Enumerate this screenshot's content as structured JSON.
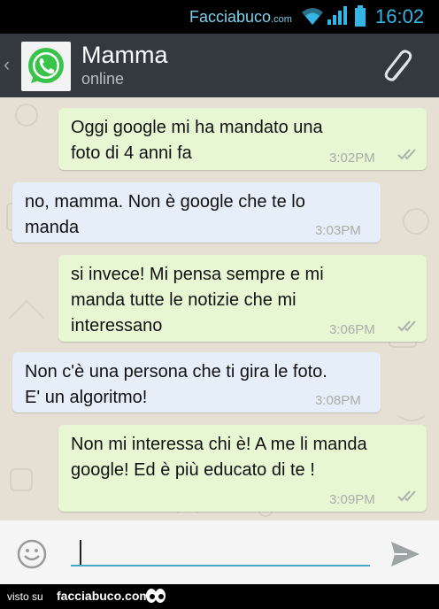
{
  "statusbar": {
    "watermark_main": "Facciabuco",
    "watermark_suffix": ".com",
    "time": "16:02"
  },
  "header": {
    "back_glyph": "‹",
    "contact_name": "Mamma",
    "contact_status": "online"
  },
  "messages": [
    {
      "direction": "out",
      "text": "Oggi google mi ha mandato una foto di 4 anni fa",
      "time": "3:02PM"
    },
    {
      "direction": "in",
      "text": "no, mamma. Non è google che te lo manda",
      "time": "3:03PM"
    },
    {
      "direction": "out",
      "text": "si invece! Mi pensa sempre e mi manda tutte le notizie che mi interessano",
      "time": "3:06PM"
    },
    {
      "direction": "in",
      "text": "Non c'è una persona che ti gira le foto. E' un algoritmo!",
      "time": "3:08PM"
    },
    {
      "direction": "out",
      "text": "Non mi interessa chi è! A me li manda google! Ed è più educato di te !",
      "time": "3:09PM"
    }
  ],
  "composer": {
    "value": "",
    "placeholder": ""
  },
  "footer": {
    "visto": "visto su",
    "site": "facciabuco.com"
  },
  "colors": {
    "header_bg": "#33393f",
    "outgoing_bubble": "#e7f7d4",
    "incoming_bubble": "#e6eefa",
    "accent": "#33b5e5",
    "whatsapp_green": "#39c34b"
  },
  "icons": {
    "avatar": "whatsapp-logo-icon",
    "attach": "paperclip-icon",
    "emoji": "smiley-icon",
    "send": "send-arrow-icon",
    "read_receipt": "double-check-icon"
  }
}
